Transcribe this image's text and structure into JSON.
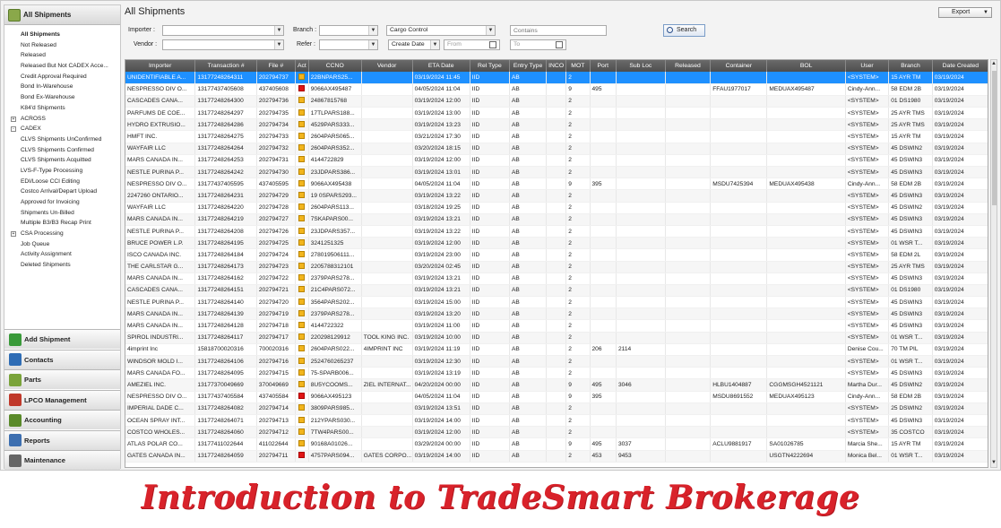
{
  "colors": {
    "selected_row": "#1e90ff",
    "status_yellow": "#f2b51c",
    "status_red": "#e01515",
    "banner": "#d9222a"
  },
  "sidebar": {
    "header": "All Shipments",
    "items": [
      {
        "label": "All Shipments",
        "bold": true
      },
      {
        "label": "Not Released"
      },
      {
        "label": "Released"
      },
      {
        "label": "Released But Not CADEX Acce..."
      },
      {
        "label": "Credit Approval Required"
      },
      {
        "label": "Bond In-Warehouse"
      },
      {
        "label": "Bond Ex-Warehouse"
      },
      {
        "label": "K84'd Shipments"
      },
      {
        "label": "ACROSS",
        "expand": "+"
      },
      {
        "label": "CADEX",
        "expand": "-"
      },
      {
        "label": "CLVS Shipments UnConfirmed"
      },
      {
        "label": "CLVS Shipments Confirmed"
      },
      {
        "label": "CLVS Shipments Acquitted"
      },
      {
        "label": "LVS-F-Type Processing"
      },
      {
        "label": "EDI/Loose CCI Editing"
      },
      {
        "label": "Costco Arrival/Depart Upload"
      },
      {
        "label": "Approved for Invoicing"
      },
      {
        "label": "Shipments Un-Billed"
      },
      {
        "label": "Multiple B3/B3 Recap Print"
      },
      {
        "label": "CSA Processing",
        "expand": "+"
      },
      {
        "label": "Job Queue"
      },
      {
        "label": "Activity Assignment"
      },
      {
        "label": "Deleted Shipments"
      }
    ],
    "nav": [
      {
        "label": "Add Shipment",
        "icon": "add-shipment-icon",
        "color": "#3a9a3a"
      },
      {
        "label": "Contacts",
        "icon": "contacts-icon",
        "color": "#2f6db5"
      },
      {
        "label": "Parts",
        "icon": "parts-icon",
        "color": "#7aa33a"
      },
      {
        "label": "LPCO Management",
        "icon": "lpco-icon",
        "color": "#c0392b"
      },
      {
        "label": "Accounting",
        "icon": "accounting-icon",
        "color": "#5a8a2a"
      },
      {
        "label": "Reports",
        "icon": "reports-icon",
        "color": "#3d6fb0"
      },
      {
        "label": "Maintenance",
        "icon": "maintenance-icon",
        "color": "#666666"
      }
    ]
  },
  "main": {
    "title": "All Shipments",
    "export_label": "Export",
    "filters": {
      "importer_label": "Importer :",
      "vendor_label": "Vendor :",
      "branch_label": "Branch :",
      "refer_label": "Refer :",
      "field_select": "Cargo Control",
      "contains_placeholder": "Contains",
      "date_select": "Create Date",
      "from_placeholder": "From",
      "to_placeholder": "To",
      "search_label": "Search"
    },
    "columns": [
      "Importer",
      "Transaction #",
      "File #",
      "Act",
      "CCNO",
      "Vendor",
      "ETA Date",
      "Rel Type",
      "Entry Type",
      "INCO",
      "MOT",
      "Port",
      "Sub Loc",
      "Released",
      "Container",
      "BOL",
      "User",
      "Branch",
      "Date Created"
    ],
    "rows": [
      [
        "UNIDENTIFIABLE A...",
        "13177248264311",
        "202794737",
        "y",
        "22BNPARS25...",
        "",
        "03/19/2024 11:45",
        "IID",
        "AB",
        "",
        "2",
        "",
        "",
        "",
        "",
        "",
        "<SYSTEM>",
        "15 AYR TM",
        "03/19/2024"
      ],
      [
        "NESPRESSO DIV O...",
        "13177437405608",
        "437405608",
        "r",
        "9066AX495487",
        "",
        "04/05/2024 11:04",
        "IID",
        "AB",
        "",
        "9",
        "495",
        "",
        "",
        "FFAU1977017",
        "MEDUAX495487",
        "Cindy-Ann...",
        "58 EDM 2B",
        "03/19/2024"
      ],
      [
        "CASCADES CANA...",
        "13177248264300",
        "202794736",
        "y",
        "24867815768",
        "",
        "03/19/2024 12:00",
        "IID",
        "AB",
        "",
        "2",
        "",
        "",
        "",
        "",
        "",
        "<SYSTEM>",
        "01 DS1980",
        "03/19/2024"
      ],
      [
        "PARFUMS DE COE...",
        "13177248264297",
        "202794735",
        "y",
        "17TLPARS188...",
        "",
        "03/19/2024 13:00",
        "IID",
        "AB",
        "",
        "2",
        "",
        "",
        "",
        "",
        "",
        "<SYSTEM>",
        "25 AYR TMS",
        "03/19/2024"
      ],
      [
        "HYDRO EXTRUSIO...",
        "13177248264286",
        "202794734",
        "y",
        "4529PARS333...",
        "",
        "03/19/2024 13:23",
        "IID",
        "AB",
        "",
        "2",
        "",
        "",
        "",
        "",
        "",
        "<SYSTEM>",
        "25 AYR TMS",
        "03/19/2024"
      ],
      [
        "HMFT INC.",
        "13177248264275",
        "202794733",
        "y",
        "2604PARS065...",
        "",
        "03/21/2024 17:30",
        "IID",
        "AB",
        "",
        "2",
        "",
        "",
        "",
        "",
        "",
        "<SYSTEM>",
        "15 AYR TM",
        "03/19/2024"
      ],
      [
        "WAYFAIR LLC",
        "13177248264264",
        "202794732",
        "y",
        "2604PARS352...",
        "",
        "03/20/2024 18:15",
        "IID",
        "AB",
        "",
        "2",
        "",
        "",
        "",
        "",
        "",
        "<SYSTEM>",
        "45 DSWIN2",
        "03/19/2024"
      ],
      [
        "MARS CANADA IN...",
        "13177248264253",
        "202794731",
        "y",
        "4144722829",
        "",
        "03/19/2024 12:00",
        "IID",
        "AB",
        "",
        "2",
        "",
        "",
        "",
        "",
        "",
        "<SYSTEM>",
        "45 DSWIN3",
        "03/19/2024"
      ],
      [
        "NESTLE PURINA P...",
        "13177248264242",
        "202794730",
        "y",
        "23JDPARS386...",
        "",
        "03/19/2024 13:01",
        "IID",
        "AB",
        "",
        "2",
        "",
        "",
        "",
        "",
        "",
        "<SYSTEM>",
        "45 DSWIN3",
        "03/19/2024"
      ],
      [
        "NESPRESSO DIV O...",
        "13177437405595",
        "437405595",
        "y",
        "9066AX495438",
        "",
        "04/05/2024 11:04",
        "IID",
        "AB",
        "",
        "9",
        "395",
        "",
        "",
        "MSDU7425394",
        "MEDUAX495438",
        "Cindy-Ann...",
        "58 EDM 2B",
        "03/19/2024"
      ],
      [
        "2247260 ONTARIO...",
        "13177248264231",
        "202794729",
        "y",
        "19 0SPARS293...",
        "",
        "03/19/2024 13:22",
        "IID",
        "AB",
        "",
        "2",
        "",
        "",
        "",
        "",
        "",
        "<SYSTEM>",
        "45 DSWIN3",
        "03/19/2024"
      ],
      [
        "WAYFAIR LLC",
        "13177248264220",
        "202794728",
        "y",
        "2604PARS113...",
        "",
        "03/18/2024 19:25",
        "IID",
        "AB",
        "",
        "2",
        "",
        "",
        "",
        "",
        "",
        "<SYSTEM>",
        "45 DSWIN2",
        "03/19/2024"
      ],
      [
        "MARS CANADA IN...",
        "13177248264219",
        "202794727",
        "y",
        "7SKAPARS00...",
        "",
        "03/19/2024 13:21",
        "IID",
        "AB",
        "",
        "2",
        "",
        "",
        "",
        "",
        "",
        "<SYSTEM>",
        "45 DSWIN3",
        "03/19/2024"
      ],
      [
        "NESTLE PURINA P...",
        "13177248264208",
        "202794726",
        "y",
        "23JDPARS357...",
        "",
        "03/19/2024 13:22",
        "IID",
        "AB",
        "",
        "2",
        "",
        "",
        "",
        "",
        "",
        "<SYSTEM>",
        "45 DSWIN3",
        "03/19/2024"
      ],
      [
        "BRUCE POWER L.P.",
        "13177248264195",
        "202794725",
        "y",
        "3241251325",
        "",
        "03/19/2024 12:00",
        "IID",
        "AB",
        "",
        "2",
        "",
        "",
        "",
        "",
        "",
        "<SYSTEM>",
        "01 WSR T...",
        "03/19/2024"
      ],
      [
        "ISCO CANADA INC.",
        "13177248264184",
        "202794724",
        "y",
        "278019506111...",
        "",
        "03/19/2024 23:00",
        "IID",
        "AB",
        "",
        "2",
        "",
        "",
        "",
        "",
        "",
        "<SYSTEM>",
        "58 EDM 2L",
        "03/19/2024"
      ],
      [
        "THE CARLSTAR G...",
        "13177248264173",
        "202794723",
        "y",
        "2205788312101",
        "",
        "03/20/2024 02:45",
        "IID",
        "AB",
        "",
        "2",
        "",
        "",
        "",
        "",
        "",
        "<SYSTEM>",
        "25 AYR TMS",
        "03/19/2024"
      ],
      [
        "MARS CANADA IN...",
        "13177248264162",
        "202794722",
        "y",
        "2379PARS278...",
        "",
        "03/19/2024 13:21",
        "IID",
        "AB",
        "",
        "2",
        "",
        "",
        "",
        "",
        "",
        "<SYSTEM>",
        "45 DSWIN3",
        "03/19/2024"
      ],
      [
        "CASCADES CANA...",
        "13177248264151",
        "202794721",
        "y",
        "21C4PARS072...",
        "",
        "03/19/2024 13:21",
        "IID",
        "AB",
        "",
        "2",
        "",
        "",
        "",
        "",
        "",
        "<SYSTEM>",
        "01 DS1980",
        "03/19/2024"
      ],
      [
        "NESTLE PURINA P...",
        "13177248264140",
        "202794720",
        "y",
        "3564PARS202...",
        "",
        "03/19/2024 15:00",
        "IID",
        "AB",
        "",
        "2",
        "",
        "",
        "",
        "",
        "",
        "<SYSTEM>",
        "45 DSWIN3",
        "03/19/2024"
      ],
      [
        "MARS CANADA IN...",
        "13177248264139",
        "202794719",
        "y",
        "2379PARS278...",
        "",
        "03/19/2024 13:20",
        "IID",
        "AB",
        "",
        "2",
        "",
        "",
        "",
        "",
        "",
        "<SYSTEM>",
        "45 DSWIN3",
        "03/19/2024"
      ],
      [
        "MARS CANADA IN...",
        "13177248264128",
        "202794718",
        "y",
        "4144722322",
        "",
        "03/19/2024 11:00",
        "IID",
        "AB",
        "",
        "2",
        "",
        "",
        "",
        "",
        "",
        "<SYSTEM>",
        "45 DSWIN3",
        "03/19/2024"
      ],
      [
        "SPIROL INDUSTRI...",
        "13177248264117",
        "202794717",
        "y",
        "220298129912",
        "TOOL KING INC.",
        "03/19/2024 10:00",
        "IID",
        "AB",
        "",
        "2",
        "",
        "",
        "",
        "",
        "",
        "<SYSTEM>",
        "01 WSR T...",
        "03/19/2024"
      ],
      [
        "4imprint Inc",
        "15818700020316",
        "700020316",
        "y",
        "2604PARS022...",
        "4IMPRINT INC",
        "03/19/2024 11:19",
        "IID",
        "AB",
        "",
        "2",
        "206",
        "2114",
        "",
        "",
        "",
        "Denise Cou...",
        "70 TM PIL",
        "03/19/2024"
      ],
      [
        "WINDSOR MOLD I...",
        "13177248264106",
        "202794716",
        "y",
        "2524760265237",
        "",
        "03/19/2024 12:30",
        "IID",
        "AB",
        "",
        "2",
        "",
        "",
        "",
        "",
        "",
        "<SYSTEM>",
        "01 WSR T...",
        "03/19/2024"
      ],
      [
        "MARS CANADA FO...",
        "13177248264095",
        "202794715",
        "y",
        "75-SPARB006...",
        "",
        "03/19/2024 13:19",
        "IID",
        "AB",
        "",
        "2",
        "",
        "",
        "",
        "",
        "",
        "<SYSTEM>",
        "45 DSWIN3",
        "03/19/2024"
      ],
      [
        "AMEZIEL INC.",
        "13177370049669",
        "370049669",
        "y",
        "8U5YCOOMS...",
        "ZIEL INTERNAT...",
        "04/20/2024 00:00",
        "IID",
        "AB",
        "",
        "9",
        "495",
        "3046",
        "",
        "HLBU1404887",
        "CGGMSGH4521121",
        "Martha Dur...",
        "45 DSWIN2",
        "03/19/2024"
      ],
      [
        "NESPRESSO DIV O...",
        "13177437405584",
        "437405584",
        "r",
        "9066AX495123",
        "",
        "04/05/2024 11:04",
        "IID",
        "AB",
        "",
        "9",
        "395",
        "",
        "",
        "MSDU8691552",
        "MEDUAX495123",
        "Cindy-Ann...",
        "58 EDM 2B",
        "03/19/2024"
      ],
      [
        "IMPERIAL DADE C...",
        "13177248264082",
        "202794714",
        "y",
        "3809PARS985...",
        "",
        "03/19/2024 13:51",
        "IID",
        "AB",
        "",
        "2",
        "",
        "",
        "",
        "",
        "",
        "<SYSTEM>",
        "25 DSWIN2",
        "03/19/2024"
      ],
      [
        "OCEAN SPRAY INT...",
        "13177248264071",
        "202794713",
        "y",
        "212YPARS030...",
        "",
        "03/19/2024 14:00",
        "IID",
        "AB",
        "",
        "2",
        "",
        "",
        "",
        "",
        "",
        "<SYSTEM>",
        "45 DSWIN3",
        "03/19/2024"
      ],
      [
        "COSTCO WHOLES...",
        "13177248264060",
        "202794712",
        "y",
        "7TW4PARS00...",
        "",
        "03/19/2024 12:00",
        "IID",
        "AB",
        "",
        "2",
        "",
        "",
        "",
        "",
        "",
        "<SYSTEM>",
        "35 COSTCO",
        "03/19/2024"
      ],
      [
        "ATLAS POLAR CO...",
        "13177411022644",
        "411022644",
        "y",
        "90168A01026...",
        "",
        "03/29/2024 00:00",
        "IID",
        "AB",
        "",
        "9",
        "495",
        "3037",
        "",
        "ACLU9881917",
        "SA01026785",
        "Marcia She...",
        "15 AYR TM",
        "03/19/2024"
      ],
      [
        "GATES CANADA IN...",
        "13177248264059",
        "202794711",
        "r",
        "4757PARS094...",
        "GATES CORPO...",
        "03/19/2024 14:00",
        "IID",
        "AB",
        "",
        "2",
        "453",
        "9453",
        "",
        "",
        "USGTN4222694",
        "Monica Bel...",
        "01 WSR T...",
        "03/19/2024"
      ]
    ]
  },
  "banner": "Introduction to TradeSmart Brokerage"
}
